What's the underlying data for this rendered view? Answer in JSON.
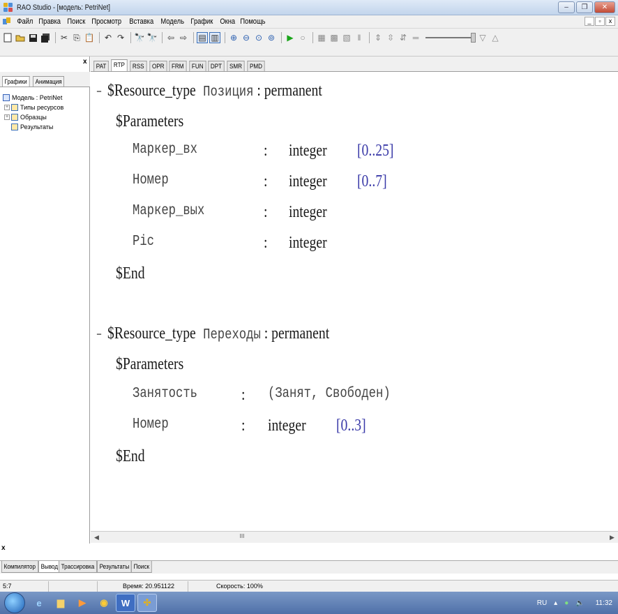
{
  "window": {
    "title": "RAO Studio - [модель: PetriNet]"
  },
  "menu": [
    "Файл",
    "Правка",
    "Поиск",
    "Просмотр",
    "Вставка",
    "Модель",
    "График",
    "Окна",
    "Помощь"
  ],
  "left_panel": {
    "tabs": [
      "Графики",
      "Анимация"
    ],
    "close": "x",
    "tree": {
      "root": "Модель : PetriNet",
      "children": [
        "Типы ресурсов",
        "Образцы",
        "Результаты"
      ]
    }
  },
  "editor": {
    "tabs": [
      "PAT",
      "RTP",
      "RSS",
      "OPR",
      "FRM",
      "FUN",
      "DPT",
      "SMR",
      "PMD"
    ],
    "active_tab": "RTP",
    "code": {
      "l1_fold": "-",
      "l1_kw": "$Resource_type",
      "l1_name": " Позиция",
      "l1_rest": " : permanent",
      "l2": "$Parameters",
      "l3_name": "Маркер_вх",
      "l3_colon": ":",
      "l3_type": "integer",
      "l3_range": "[0..25]",
      "l4_name": "Номер",
      "l4_colon": ":",
      "l4_type": "integer",
      "l4_range": "[0..7]",
      "l5_name": "Маркер_вых",
      "l5_colon": ":",
      "l5_type": "integer",
      "l6_name": "Pic",
      "l6_colon": ":",
      "l6_type": "integer",
      "l7": "$End",
      "l8_fold": "-",
      "l8_kw": "$Resource_type",
      "l8_name": " Переходы",
      "l8_rest": " : permanent",
      "l9": "$Parameters",
      "l10_name": "Занятость",
      "l10_colon": ":",
      "l10_type": "(Занят, Свободен)",
      "l11_name": "Номер",
      "l11_colon": ":",
      "l11_type": "integer",
      "l11_range": "[0..3]",
      "l12": "$End"
    },
    "scroll_thumb": "III"
  },
  "output": {
    "close": "x",
    "tabs": [
      "Компилятор",
      "Вывод",
      "Трассировка",
      "Результаты",
      "Поиск"
    ],
    "active_tab": "Вывод"
  },
  "status": {
    "position": "5:7",
    "time": "Время: 20.951122",
    "speed": "Скорость: 100%"
  },
  "taskbar": {
    "lang": "RU",
    "clock": "11:32"
  },
  "colors": {
    "accent": "#3a3aa8",
    "taskbar": "#5a7cb5"
  }
}
